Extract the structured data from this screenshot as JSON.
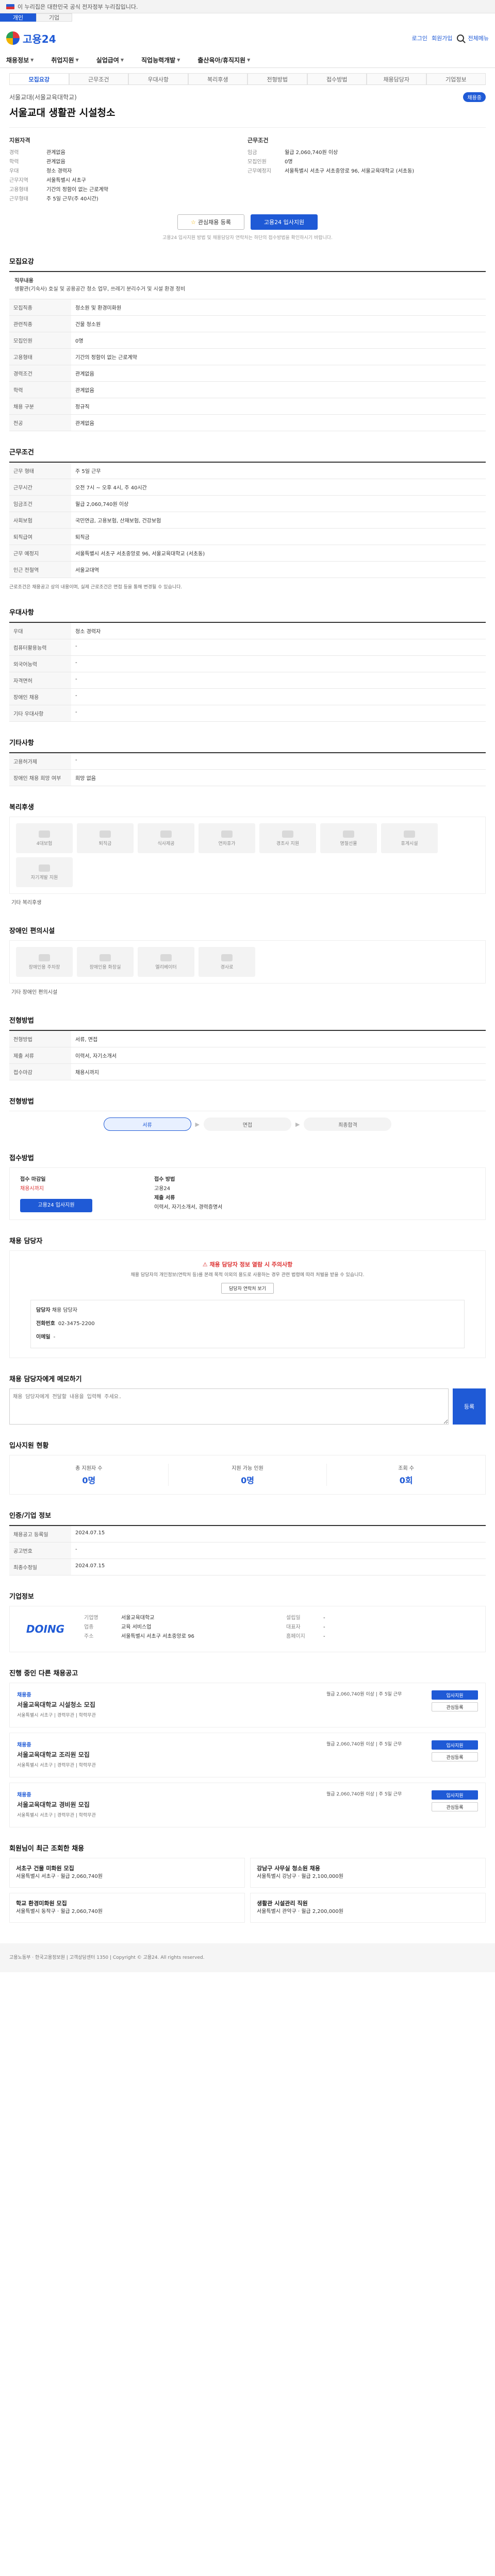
{
  "gov_bar": {
    "text": "이 누리집은 대한민국 공식 전자정부 누리집입니다."
  },
  "top_tabs": [
    "개인",
    "기업"
  ],
  "header": {
    "logo": "고용24",
    "login": "로그인",
    "join": "회원가입",
    "sitemap": "전체메뉴"
  },
  "nav": [
    "채용정보",
    "취업지원",
    "실업급여",
    "직업능력개발",
    "출산육아/휴직지원"
  ],
  "sub_tabs": [
    "모집요강",
    "근무조건",
    "우대사항",
    "복리후생",
    "전형방법",
    "접수방법",
    "채용담당자",
    "기업정보"
  ],
  "company": {
    "name": "서울교대(서울교육대학교)",
    "status": "채용중",
    "title": "서울교대 생활관 시설청소"
  },
  "summary": {
    "left_title": "지원자격",
    "left": [
      {
        "k": "경력",
        "v": "관계없음"
      },
      {
        "k": "학력",
        "v": "관계없음"
      },
      {
        "k": "우대",
        "v": "청소 경력자"
      },
      {
        "k": "근무지역",
        "v": "서울특별시 서초구"
      },
      {
        "k": "고용형태",
        "v": "기간의 정함이 없는 근로계약"
      },
      {
        "k": "근무형태",
        "v": "주 5일 근무(주 40시간)"
      }
    ],
    "right_title": "근무조건",
    "right": [
      {
        "k": "임금",
        "v": "월급 2,060,740원 이상"
      },
      {
        "k": "모집인원",
        "v": "0명"
      },
      {
        "k": "근무예정지",
        "v": "서울특별시 서초구 서초중앙로 96, 서울교육대학교 (서초동)"
      }
    ]
  },
  "actions": {
    "save": "관심채용 등록",
    "apply": "고용24 입사지원"
  },
  "notice": "고용24 입사지원 방법 및 채용담당자 연락처는 하단의 접수방법을 확인하시기 바랍니다.",
  "sections": {
    "recruit": {
      "title": "모집요강",
      "duty_label": "직무내용",
      "duty": "생활관(기숙사) 호실 및 공용공간 청소 업무, 쓰레기 분리수거 및 시설 환경 정비",
      "rows": [
        {
          "k": "모집직종",
          "v": "청소원 및 환경미화원"
        },
        {
          "k": "관련직종",
          "v": "건물 청소원"
        },
        {
          "k": "모집인원",
          "v": "0명"
        },
        {
          "k": "고용형태",
          "v": "기간의 정함이 없는 근로계약"
        },
        {
          "k": "경력조건",
          "v": "관계없음"
        },
        {
          "k": "학력",
          "v": "관계없음"
        },
        {
          "k": "채용 구분",
          "v": "정규직"
        },
        {
          "k": "전공",
          "v": "관계없음"
        }
      ]
    },
    "work": {
      "title": "근무조건",
      "rows": [
        {
          "k": "근무 형태",
          "v": "주 5일 근무"
        },
        {
          "k": "근무시간",
          "v": "오전 7시 ~ 오후 4시, 주 40시간"
        },
        {
          "k": "임금조건",
          "v": "월급 2,060,740원 이상"
        },
        {
          "k": "사회보험",
          "v": "국민연금, 고용보험, 산재보험, 건강보험"
        },
        {
          "k": "퇴직급여",
          "v": "퇴직금"
        },
        {
          "k": "근무 예정지",
          "v": "서울특별시 서초구 서초중앙로 96, 서울교육대학교 (서초동)"
        },
        {
          "k": "인근 전철역",
          "v": "서울교대역"
        }
      ],
      "map_button": "지도 보기",
      "footnote": "근로조건은 채용공고 상의 내용이며, 실제 근로조건은 면접 등을 통해 변경될 수 있습니다."
    },
    "prefer": {
      "title": "우대사항",
      "rows": [
        {
          "k": "우대",
          "v": "청소 경력자"
        },
        {
          "k": "컴퓨터활용능력",
          "v": "-"
        },
        {
          "k": "외국어능력",
          "v": "-"
        },
        {
          "k": "자격면허",
          "v": "-"
        },
        {
          "k": "장애인 채용",
          "v": "-"
        },
        {
          "k": "기타 우대사항",
          "v": "-"
        }
      ]
    },
    "etc": {
      "title": "기타사항",
      "rows": [
        {
          "k": "고용허가제",
          "v": "-"
        },
        {
          "k": "장애인 채용 희망 여부",
          "v": "희망 없음"
        }
      ]
    },
    "welfare": {
      "title": "복리후생",
      "tiles": [
        "4대보험",
        "퇴직금",
        "식사제공",
        "연차휴가",
        "경조사 지원",
        "명절선물",
        "휴게시설",
        "자기계발 지원"
      ],
      "more": "기타 복리후생"
    },
    "disability": {
      "title": "장애인 편의시설",
      "tiles": [
        "장애인용 주차장",
        "장애인용 화장실",
        "엘리베이터",
        "경사로"
      ],
      "more": "기타 장애인 편의시설"
    },
    "selection": {
      "title": "전형방법",
      "rows": [
        {
          "k": "전형방법",
          "v": "서류, 면접"
        },
        {
          "k": "제출 서류",
          "v": "이력서, 자기소개서"
        },
        {
          "k": "접수마감",
          "v": "채용시까지"
        }
      ]
    },
    "process": {
      "title": "전형방법",
      "steps": [
        "서류",
        "면접",
        "최종합격"
      ]
    },
    "apply": {
      "title": "접수방법",
      "period_label": "접수 마감일",
      "period": "채용시까지",
      "method_label": "접수 방법",
      "method": "고용24",
      "button": "고용24 입사지원",
      "doc_label": "제출 서류",
      "doc": "이력서, 자기소개서, 경력증명서"
    },
    "contact": {
      "title": "채용 담당자",
      "warn_title": "채용 담당자 정보 열람 시 주의사항",
      "warn": "채용 담당자의 개인정보(연락처 등)를 본래 목적 이외의 용도로 사용하는 경우 관련 법령에 따라 처벌을 받을 수 있습니다.",
      "view_button": "담당자 연락처 보기",
      "manager_label": "담당자",
      "manager": "채용 담당자",
      "phone_label": "전화번호",
      "phone": "02-3475-2200",
      "email_label": "이메일",
      "email": "-"
    },
    "memo": {
      "title": "채용 담당자에게 메모하기",
      "placeholder": "채용 담당자에게 전달할 내용을 입력해 주세요.",
      "button": "등록"
    },
    "stats": {
      "title": "입사지원 현황",
      "items": [
        {
          "label": "총 지원자 수",
          "value": "0명"
        },
        {
          "label": "지원 가능 인원",
          "value": "0명"
        },
        {
          "label": "조회 수",
          "value": "0회"
        }
      ]
    },
    "meta": {
      "title": "인증/기업 정보",
      "rows": [
        {
          "k": "채용공고 등록일",
          "v": "2024.07.15"
        },
        {
          "k": "공고번호",
          "v": "-"
        },
        {
          "k": "최종수정일",
          "v": "2024.07.15"
        }
      ]
    },
    "corp": {
      "title": "기업정보",
      "logo": "DOING",
      "left": [
        {
          "k": "기업명",
          "v": "서울교육대학교"
        },
        {
          "k": "업종",
          "v": "교육 서비스업"
        },
        {
          "k": "주소",
          "v": "서울특별시 서초구 서초중앙로 96"
        }
      ],
      "right": [
        {
          "k": "설립일",
          "v": "-"
        },
        {
          "k": "대표자",
          "v": "-"
        },
        {
          "k": "홈페이지",
          "v": "-"
        }
      ]
    },
    "others": {
      "title": "진행 중인 다른 채용공고",
      "items": [
        {
          "tag": "채용중",
          "title": "서울교육대학교 시설청소 모집",
          "meta": "서울특별시 서초구 | 경력무관 | 학력무관",
          "side": "월급 2,060,740원 이상 | 주 5일 근무",
          "btn1": "입사지원",
          "btn2": "관심등록"
        },
        {
          "tag": "채용중",
          "title": "서울교육대학교 조리원 모집",
          "meta": "서울특별시 서초구 | 경력무관 | 학력무관",
          "side": "월급 2,060,740원 이상 | 주 5일 근무",
          "btn1": "입사지원",
          "btn2": "관심등록"
        },
        {
          "tag": "채용중",
          "title": "서울교육대학교 경비원 모집",
          "meta": "서울특별시 서초구 | 경력무관 | 학력무관",
          "side": "월급 2,060,740원 이상 | 주 5일 근무",
          "btn1": "입사지원",
          "btn2": "관심등록"
        }
      ]
    },
    "rec": {
      "title": "회원님이 최근 조회한 채용",
      "items": [
        {
          "t": "서초구 건물 미화원 모집",
          "d": "서울특별시 서초구 · 월급 2,060,740원"
        },
        {
          "t": "강남구 사무실 청소원 채용",
          "d": "서울특별시 강남구 · 월급 2,100,000원"
        },
        {
          "t": "학교 환경미화원 모집",
          "d": "서울특별시 동작구 · 월급 2,060,740원"
        },
        {
          "t": "생활관 시설관리 직원",
          "d": "서울특별시 관악구 · 월급 2,200,000원"
        }
      ]
    }
  },
  "footer": "고용노동부 · 한국고용정보원 | 고객상담센터 1350 | Copyright © 고용24. All rights reserved."
}
